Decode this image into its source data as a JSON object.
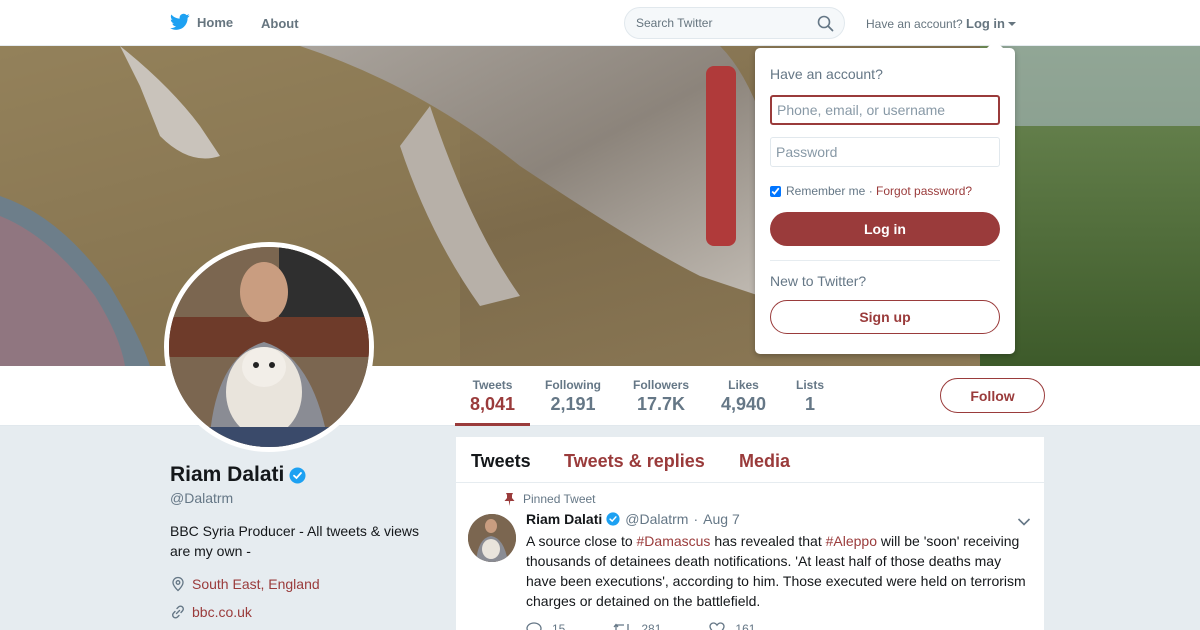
{
  "nav": {
    "home_label": "Home",
    "about_label": "About",
    "search_placeholder": "Search Twitter",
    "have_account": "Have an account?",
    "login_label": "Log in"
  },
  "profile": {
    "name": "Riam Dalati",
    "handle": "@Dalatrm",
    "bio": "BBC Syria Producer - All tweets & views are my own -",
    "location": "South East, England",
    "website": "bbc.co.uk",
    "follow_label": "Follow"
  },
  "stats": [
    {
      "label": "Tweets",
      "value": "8,041"
    },
    {
      "label": "Following",
      "value": "2,191"
    },
    {
      "label": "Followers",
      "value": "17.7K"
    },
    {
      "label": "Likes",
      "value": "4,940"
    },
    {
      "label": "Lists",
      "value": "1"
    }
  ],
  "timeline": {
    "tabs": [
      "Tweets",
      "Tweets & replies",
      "Media"
    ]
  },
  "tweet": {
    "pinned_label": "Pinned Tweet",
    "name": "Riam Dalati",
    "handle": "@Dalatrm",
    "dot": "·",
    "date": "Aug 7",
    "text_1": "A source close to ",
    "hashtag_1": "#Damascus",
    "text_2": " has revealed that ",
    "hashtag_2": "#Aleppo",
    "text_3": " will be 'soon' receiving thousands of detainees death notifications. 'At least half of those deaths may have been executions', according to him. Those executed were held on terrorism charges or detained on the battlefield.",
    "reply_count": "15",
    "retweet_count": "281",
    "like_count": "161"
  },
  "login_dropdown": {
    "title": "Have an account?",
    "username_placeholder": "Phone, email, or username",
    "password_placeholder": "Password",
    "remember_label": "Remember me",
    "separator": " · ",
    "forgot_label": "Forgot password?",
    "login_button": "Log in",
    "new_label": "New to Twitter?",
    "signup_button": "Sign up"
  },
  "colors": {
    "accent": "#9a3b3b",
    "twitter_blue": "#1da1f2",
    "muted": "#657786"
  }
}
